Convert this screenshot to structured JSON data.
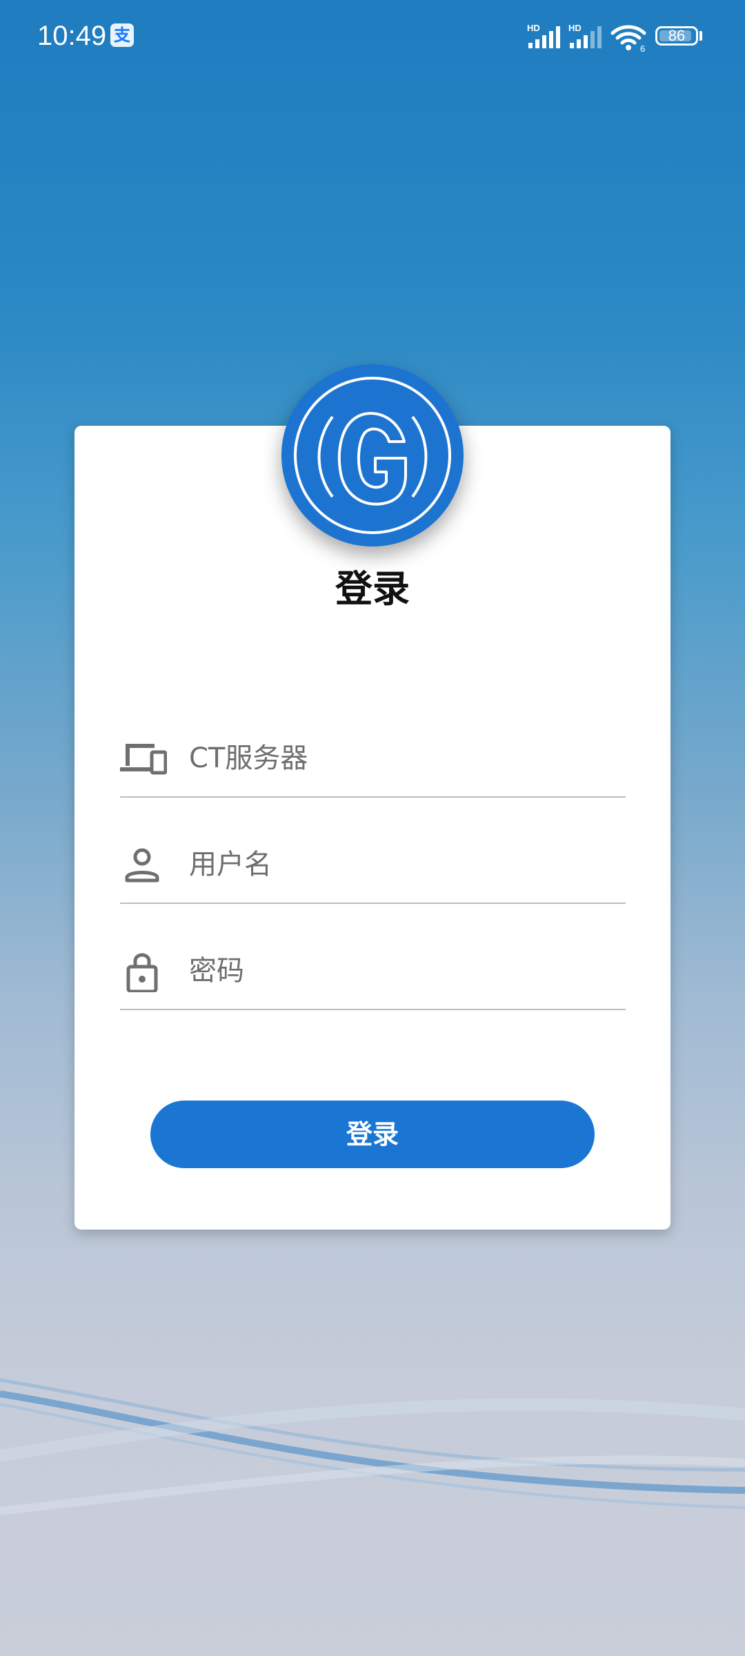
{
  "status_bar": {
    "time": "10:49",
    "alipay_badge": "支",
    "signal_1_label": "HD",
    "signal_2_label": "HD",
    "wifi_label": "6",
    "battery": "86"
  },
  "login": {
    "title": "登录",
    "server_placeholder": "CT服务器",
    "username_placeholder": "用户名",
    "password_placeholder": "密码",
    "submit_label": "登录"
  },
  "colors": {
    "accent": "#1b76d3",
    "logo_background": "#1d74d0"
  },
  "icons": {
    "server": "devices-icon",
    "username": "person-icon",
    "password": "lock-icon",
    "logo": "g-logo-icon"
  }
}
